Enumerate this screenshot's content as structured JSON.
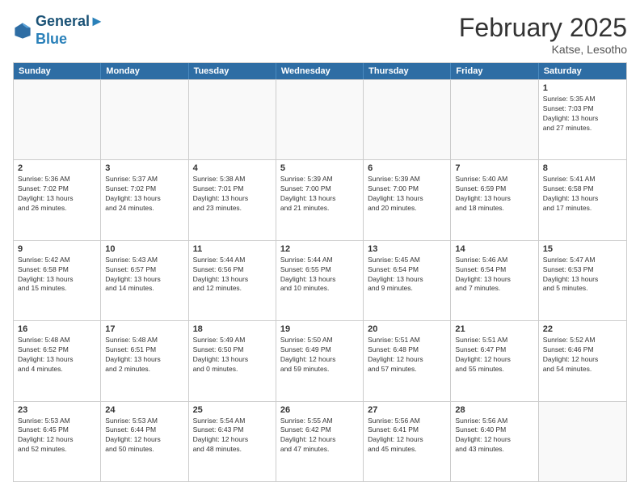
{
  "header": {
    "logo_line1": "General",
    "logo_line2": "Blue",
    "month": "February 2025",
    "location": "Katse, Lesotho"
  },
  "days_of_week": [
    "Sunday",
    "Monday",
    "Tuesday",
    "Wednesday",
    "Thursday",
    "Friday",
    "Saturday"
  ],
  "weeks": [
    [
      {
        "day": "",
        "info": ""
      },
      {
        "day": "",
        "info": ""
      },
      {
        "day": "",
        "info": ""
      },
      {
        "day": "",
        "info": ""
      },
      {
        "day": "",
        "info": ""
      },
      {
        "day": "",
        "info": ""
      },
      {
        "day": "1",
        "info": "Sunrise: 5:35 AM\nSunset: 7:03 PM\nDaylight: 13 hours\nand 27 minutes."
      }
    ],
    [
      {
        "day": "2",
        "info": "Sunrise: 5:36 AM\nSunset: 7:02 PM\nDaylight: 13 hours\nand 26 minutes."
      },
      {
        "day": "3",
        "info": "Sunrise: 5:37 AM\nSunset: 7:02 PM\nDaylight: 13 hours\nand 24 minutes."
      },
      {
        "day": "4",
        "info": "Sunrise: 5:38 AM\nSunset: 7:01 PM\nDaylight: 13 hours\nand 23 minutes."
      },
      {
        "day": "5",
        "info": "Sunrise: 5:39 AM\nSunset: 7:00 PM\nDaylight: 13 hours\nand 21 minutes."
      },
      {
        "day": "6",
        "info": "Sunrise: 5:39 AM\nSunset: 7:00 PM\nDaylight: 13 hours\nand 20 minutes."
      },
      {
        "day": "7",
        "info": "Sunrise: 5:40 AM\nSunset: 6:59 PM\nDaylight: 13 hours\nand 18 minutes."
      },
      {
        "day": "8",
        "info": "Sunrise: 5:41 AM\nSunset: 6:58 PM\nDaylight: 13 hours\nand 17 minutes."
      }
    ],
    [
      {
        "day": "9",
        "info": "Sunrise: 5:42 AM\nSunset: 6:58 PM\nDaylight: 13 hours\nand 15 minutes."
      },
      {
        "day": "10",
        "info": "Sunrise: 5:43 AM\nSunset: 6:57 PM\nDaylight: 13 hours\nand 14 minutes."
      },
      {
        "day": "11",
        "info": "Sunrise: 5:44 AM\nSunset: 6:56 PM\nDaylight: 13 hours\nand 12 minutes."
      },
      {
        "day": "12",
        "info": "Sunrise: 5:44 AM\nSunset: 6:55 PM\nDaylight: 13 hours\nand 10 minutes."
      },
      {
        "day": "13",
        "info": "Sunrise: 5:45 AM\nSunset: 6:54 PM\nDaylight: 13 hours\nand 9 minutes."
      },
      {
        "day": "14",
        "info": "Sunrise: 5:46 AM\nSunset: 6:54 PM\nDaylight: 13 hours\nand 7 minutes."
      },
      {
        "day": "15",
        "info": "Sunrise: 5:47 AM\nSunset: 6:53 PM\nDaylight: 13 hours\nand 5 minutes."
      }
    ],
    [
      {
        "day": "16",
        "info": "Sunrise: 5:48 AM\nSunset: 6:52 PM\nDaylight: 13 hours\nand 4 minutes."
      },
      {
        "day": "17",
        "info": "Sunrise: 5:48 AM\nSunset: 6:51 PM\nDaylight: 13 hours\nand 2 minutes."
      },
      {
        "day": "18",
        "info": "Sunrise: 5:49 AM\nSunset: 6:50 PM\nDaylight: 13 hours\nand 0 minutes."
      },
      {
        "day": "19",
        "info": "Sunrise: 5:50 AM\nSunset: 6:49 PM\nDaylight: 12 hours\nand 59 minutes."
      },
      {
        "day": "20",
        "info": "Sunrise: 5:51 AM\nSunset: 6:48 PM\nDaylight: 12 hours\nand 57 minutes."
      },
      {
        "day": "21",
        "info": "Sunrise: 5:51 AM\nSunset: 6:47 PM\nDaylight: 12 hours\nand 55 minutes."
      },
      {
        "day": "22",
        "info": "Sunrise: 5:52 AM\nSunset: 6:46 PM\nDaylight: 12 hours\nand 54 minutes."
      }
    ],
    [
      {
        "day": "23",
        "info": "Sunrise: 5:53 AM\nSunset: 6:45 PM\nDaylight: 12 hours\nand 52 minutes."
      },
      {
        "day": "24",
        "info": "Sunrise: 5:53 AM\nSunset: 6:44 PM\nDaylight: 12 hours\nand 50 minutes."
      },
      {
        "day": "25",
        "info": "Sunrise: 5:54 AM\nSunset: 6:43 PM\nDaylight: 12 hours\nand 48 minutes."
      },
      {
        "day": "26",
        "info": "Sunrise: 5:55 AM\nSunset: 6:42 PM\nDaylight: 12 hours\nand 47 minutes."
      },
      {
        "day": "27",
        "info": "Sunrise: 5:56 AM\nSunset: 6:41 PM\nDaylight: 12 hours\nand 45 minutes."
      },
      {
        "day": "28",
        "info": "Sunrise: 5:56 AM\nSunset: 6:40 PM\nDaylight: 12 hours\nand 43 minutes."
      },
      {
        "day": "",
        "info": ""
      }
    ]
  ]
}
